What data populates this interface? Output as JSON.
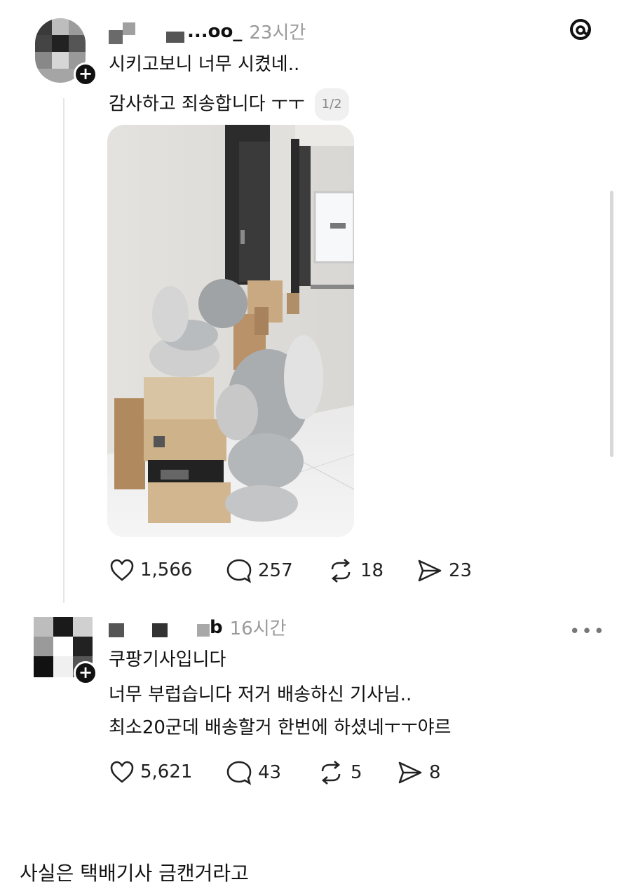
{
  "post1": {
    "username_visible": "...oo_",
    "time": "23시간",
    "lines": [
      "시키고보니 너무 시켰네..",
      "감사하고 죄송합니다 ㅜㅜ"
    ],
    "pager": "1/2",
    "actions": {
      "likes": "1,566",
      "comments": "257",
      "reposts": "18",
      "shares": "23"
    }
  },
  "post2": {
    "username_visible": "b",
    "time": "16시간",
    "lines": [
      "쿠팡기사입니다",
      "너무 부럽습니다 저거 배송하신 기사님..",
      "최소20군데 배송할거 한번에 하셨네ㅜㅜ야르"
    ],
    "more": "•••",
    "actions": {
      "likes": "5,621",
      "comments": "43",
      "reposts": "5",
      "shares": "8"
    }
  },
  "footer_caption": "사실은 택배기사 금캔거라고",
  "icons": {
    "logo": "threads-logo-icon",
    "like": "heart-icon",
    "comment": "comment-bubble-icon",
    "repost": "repost-icon",
    "share": "send-icon"
  }
}
